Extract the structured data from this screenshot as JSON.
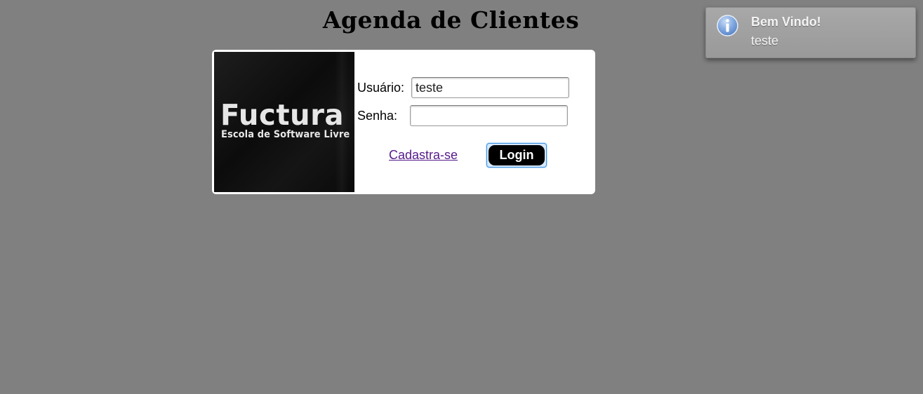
{
  "page": {
    "title": "Agenda de Clientes",
    "background_color": "#808080"
  },
  "logo": {
    "name": "Fuctura",
    "tagline": "Escola de Software Livre"
  },
  "login_form": {
    "username_label": "Usuário:",
    "username_value": "teste",
    "password_label": "Senha:",
    "password_value": "",
    "register_link": "Cadastra-se",
    "login_button": "Login",
    "link_color": "#551a8b",
    "button_color": "#000000"
  },
  "notification": {
    "icon": "info-icon",
    "title": "Bem Vindo!",
    "message": "teste"
  }
}
